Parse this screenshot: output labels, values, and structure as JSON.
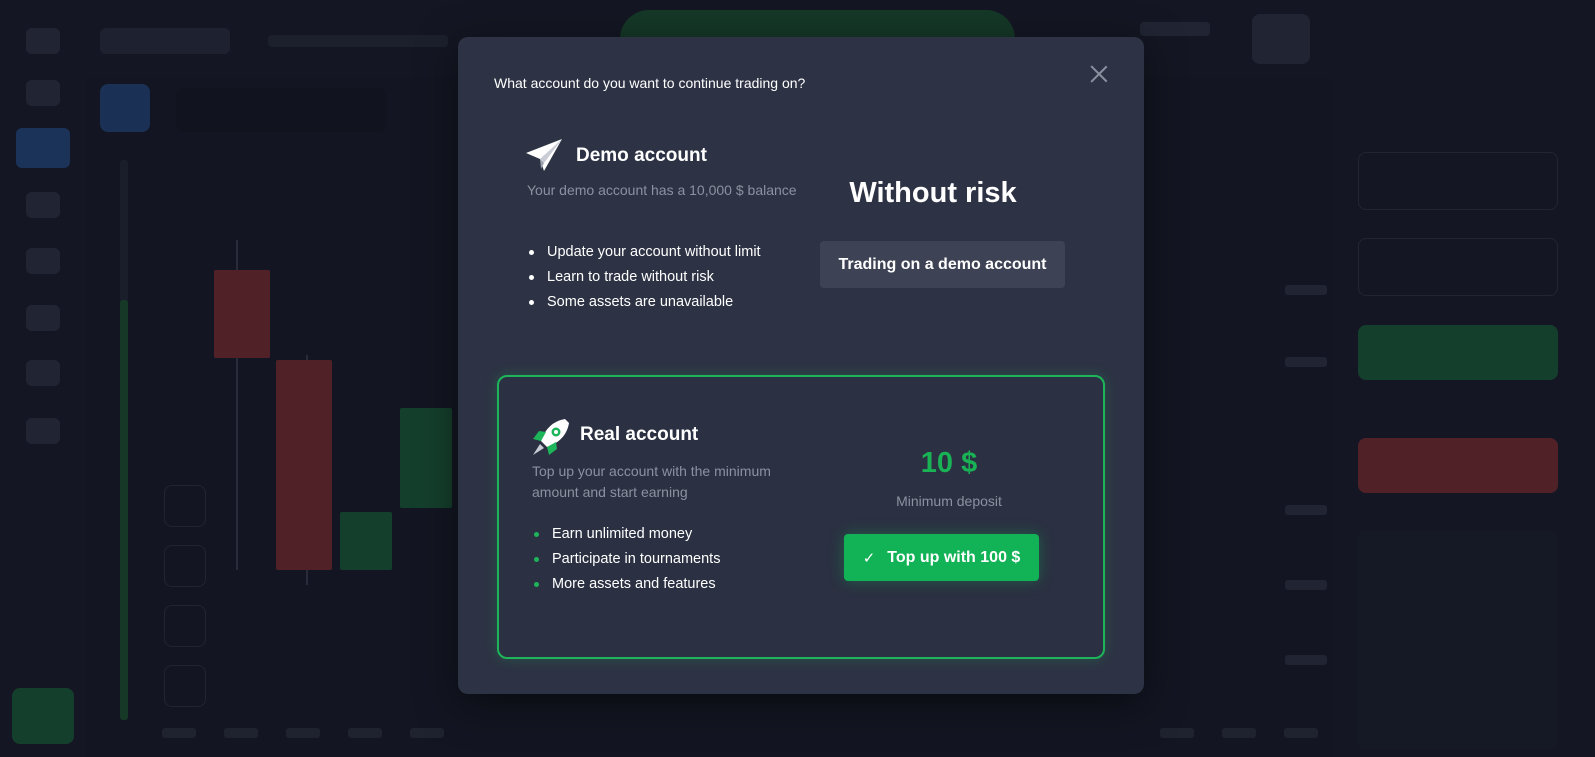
{
  "modal": {
    "title": "What account do you want to continue trading on?",
    "close_icon": "close-icon"
  },
  "demo": {
    "icon": "paper-plane-icon",
    "title": "Demo account",
    "description": "Your demo account has a 10,000 $ balance",
    "bullets": [
      "Update your account without limit",
      "Learn to trade without risk",
      "Some assets are unavailable"
    ],
    "headline": "Without risk",
    "button_label": "Trading on a demo account"
  },
  "real": {
    "icon": "rocket-icon",
    "title": "Real account",
    "description": "Top up your account with the minimum amount and start earning",
    "bullets": [
      "Earn unlimited money",
      "Participate in tournaments",
      "More assets and features"
    ],
    "amount": "10 $",
    "amount_label": "Minimum deposit",
    "button_icon": "check-icon",
    "button_label": "Top up with 100 $"
  },
  "colors": {
    "accent_green": "#12b256",
    "highlight_red": "#e0202a",
    "modal_bg": "#2d3344",
    "muted_text": "#8b91a1"
  }
}
